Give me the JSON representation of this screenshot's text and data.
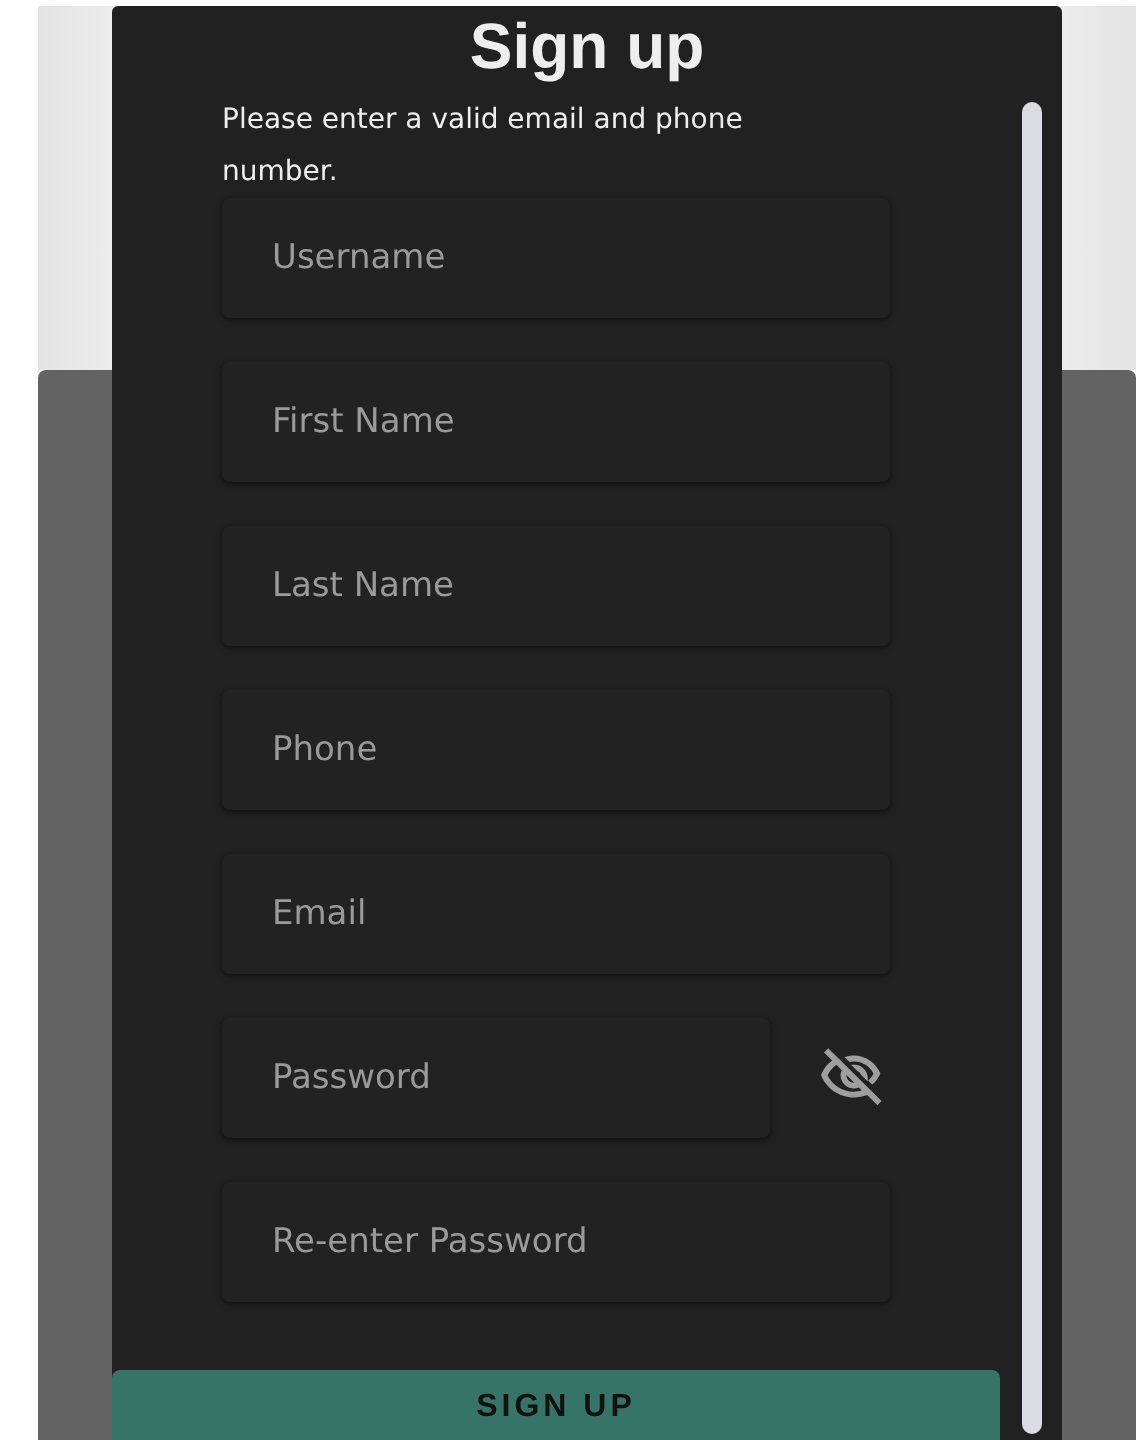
{
  "dialog": {
    "title": "Sign up",
    "message": "Please enter a valid email and phone number.",
    "fields": [
      {
        "placeholder": "Username",
        "toggle": false
      },
      {
        "placeholder": "First Name",
        "toggle": false
      },
      {
        "placeholder": "Last Name",
        "toggle": false
      },
      {
        "placeholder": "Phone",
        "toggle": false
      },
      {
        "placeholder": "Email",
        "toggle": false
      },
      {
        "placeholder": "Password",
        "toggle": true
      },
      {
        "placeholder": "Re-enter Password",
        "toggle": false
      }
    ],
    "button": "SIGN UP"
  }
}
